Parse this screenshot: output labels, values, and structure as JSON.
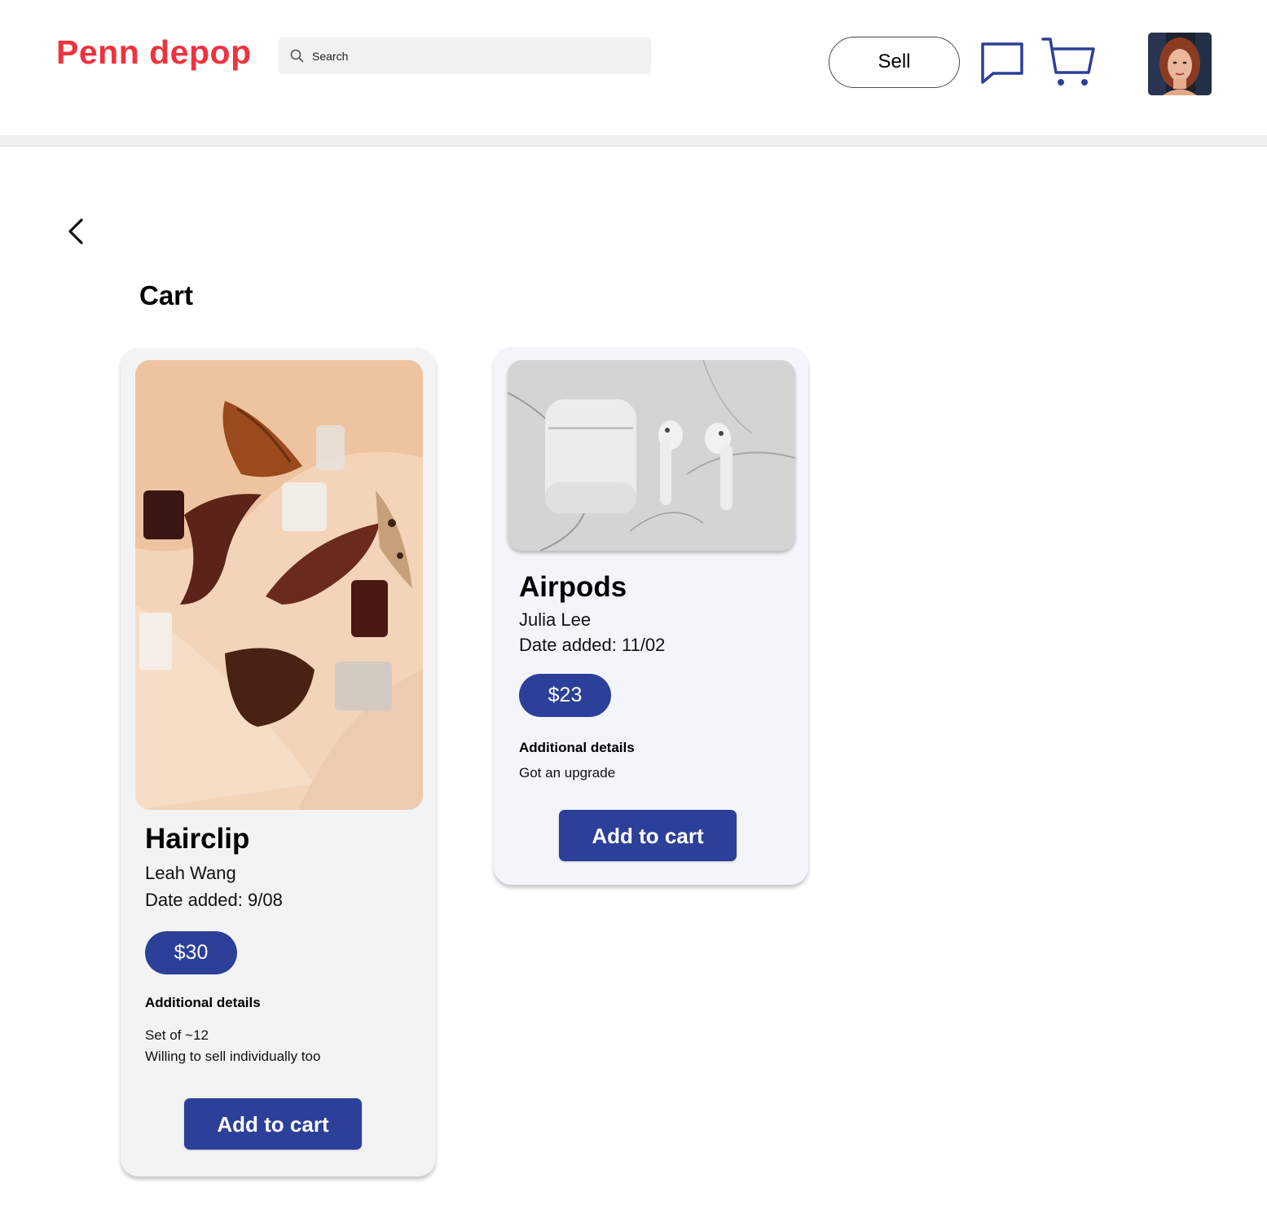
{
  "header": {
    "logo": "Penn depop",
    "search_placeholder": "Search",
    "sell_label": "Sell",
    "icons": {
      "search": "search-icon",
      "messages": "message-bubble-icon",
      "cart": "shopping-cart-icon",
      "avatar": "user-avatar"
    }
  },
  "page": {
    "back_icon": "chevron-left-icon",
    "title": "Cart"
  },
  "items": [
    {
      "title": "Hairclip",
      "seller": "Leah Wang",
      "date_added": "Date added: 9/08",
      "price": "$30",
      "details_heading": "Additional details",
      "details": [
        "Set of ~12",
        "Willing to sell individually too"
      ],
      "button_label": "Add to cart"
    },
    {
      "title": "Airpods",
      "seller": "Julia Lee",
      "date_added": "Date added: 11/02",
      "price": "$23",
      "details_heading": "Additional details",
      "details": [
        "Got an upgrade"
      ],
      "button_label": "Add to cart"
    }
  ],
  "colors": {
    "brand": "#f0323f",
    "accent": "#2c3f99",
    "icon_stroke": "#2c3f99"
  }
}
